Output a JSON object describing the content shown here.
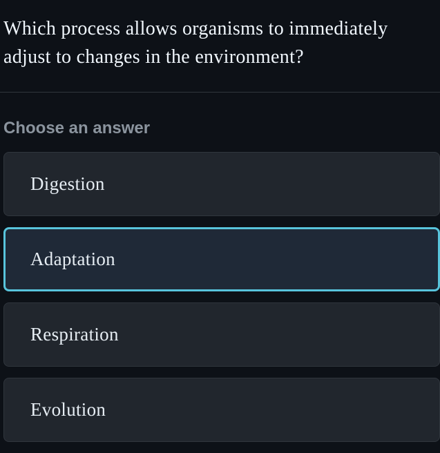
{
  "question": "Which process allows organisms to immediately adjust to changes in the environment?",
  "choose_label": "Choose an answer",
  "answers": [
    {
      "label": "Digestion",
      "selected": false
    },
    {
      "label": "Adaptation",
      "selected": true
    },
    {
      "label": "Respiration",
      "selected": false
    },
    {
      "label": "Evolution",
      "selected": false
    }
  ]
}
